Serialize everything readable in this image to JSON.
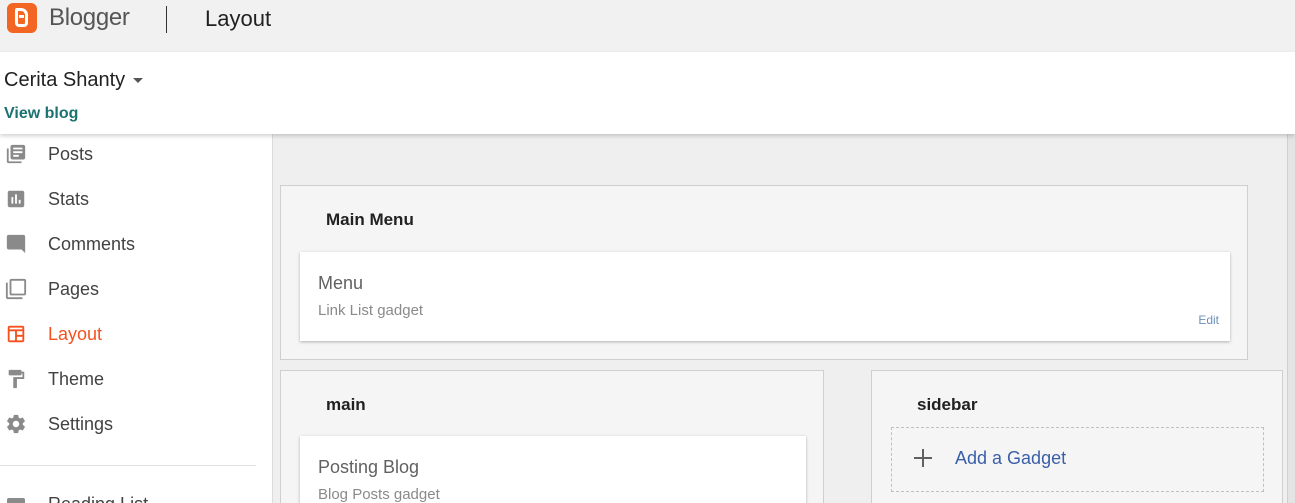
{
  "topbar": {
    "brand": "Blogger",
    "page_title": "Layout"
  },
  "blog": {
    "name": "Cerita Shanty",
    "view_blog": "View blog"
  },
  "nav": {
    "items": [
      {
        "label": "Posts",
        "icon": "posts-icon"
      },
      {
        "label": "Stats",
        "icon": "stats-icon"
      },
      {
        "label": "Comments",
        "icon": "comments-icon"
      },
      {
        "label": "Pages",
        "icon": "pages-icon"
      },
      {
        "label": "Layout",
        "icon": "layout-icon",
        "active": true
      },
      {
        "label": "Theme",
        "icon": "theme-icon"
      },
      {
        "label": "Settings",
        "icon": "settings-icon"
      }
    ],
    "partial_item": "Reading List"
  },
  "colors": {
    "accent": "#f4511e",
    "brand": "#f26522",
    "link": "#1a7370",
    "gadget_link": "#3a5fa8"
  },
  "layout": {
    "main_menu": {
      "title": "Main Menu",
      "gadget": {
        "name": "Menu",
        "type": "Link List gadget",
        "edit": "Edit"
      }
    },
    "main": {
      "title": "main",
      "gadget": {
        "name": "Posting Blog",
        "type": "Blog Posts gadget"
      }
    },
    "sidebar": {
      "title": "sidebar",
      "add_gadget": "Add a Gadget"
    }
  }
}
